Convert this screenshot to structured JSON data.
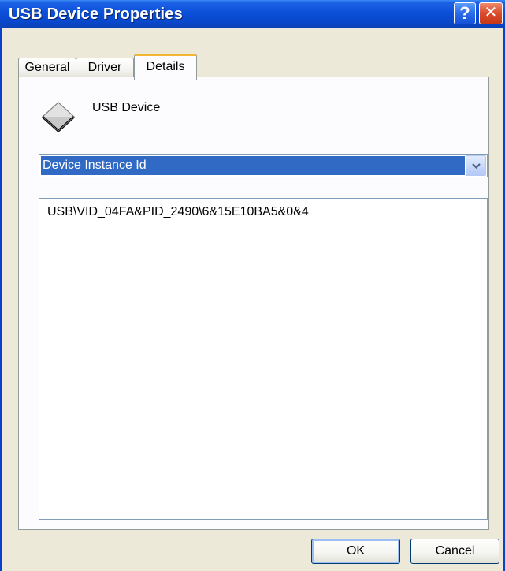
{
  "window": {
    "title": "USB Device Properties",
    "help_label": "?",
    "close_label": "✕"
  },
  "tabs": [
    {
      "label": "General",
      "active": false
    },
    {
      "label": "Driver",
      "active": false
    },
    {
      "label": "Details",
      "active": true
    }
  ],
  "details": {
    "device_icon": "usb-device-icon",
    "device_name": "USB Device",
    "property_dropdown": {
      "selected": "Device Instance Id"
    },
    "values": [
      "USB\\VID_04FA&PID_2490\\6&15E10BA5&0&4"
    ]
  },
  "buttons": {
    "ok_label": "OK",
    "cancel_label": "Cancel"
  },
  "colors": {
    "titlebar": "#0A4FD8",
    "dialog_background": "#ECE9D8",
    "selection": "#316AC5",
    "active_tab_accent": "#F2B634"
  }
}
